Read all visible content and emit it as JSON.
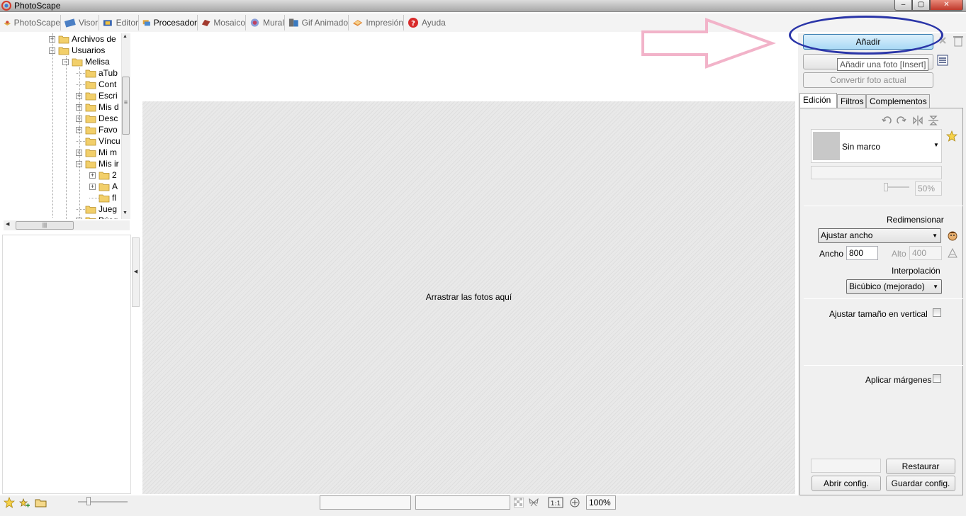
{
  "window": {
    "title": "PhotoScape",
    "controls": {
      "minimize": "–",
      "maximize": "▢",
      "close": "✕"
    }
  },
  "menu": {
    "tabs": [
      {
        "label": "PhotoScape",
        "icon": "photoscape-icon"
      },
      {
        "label": "Visor",
        "icon": "viewer-icon"
      },
      {
        "label": "Editor",
        "icon": "editor-icon"
      },
      {
        "label": "Procesador",
        "icon": "batch-icon",
        "active": true
      },
      {
        "label": "Mosaico",
        "icon": "page-icon"
      },
      {
        "label": "Mural",
        "icon": "combine-icon"
      },
      {
        "label": "Gif Animado",
        "icon": "gif-icon"
      },
      {
        "label": "Impresión",
        "icon": "print-icon"
      },
      {
        "label": "Ayuda",
        "icon": "help-icon"
      }
    ]
  },
  "tree": {
    "items": [
      {
        "label": "Archivos de",
        "expander": "+",
        "icon": "folder-icon"
      },
      {
        "label": "Usuarios",
        "expander": "−",
        "icon": "folder-icon"
      },
      {
        "label": "Melisa",
        "expander": "−",
        "icon": "folder-icon"
      },
      {
        "label": "aTub",
        "expander": "",
        "icon": "folder-icon"
      },
      {
        "label": "Cont",
        "expander": "",
        "icon": "contacts-icon"
      },
      {
        "label": "Escri",
        "expander": "+",
        "icon": "desktop-icon"
      },
      {
        "label": "Mis d",
        "expander": "+",
        "icon": "documents-icon"
      },
      {
        "label": "Desc",
        "expander": "+",
        "icon": "downloads-icon"
      },
      {
        "label": "Favo",
        "expander": "+",
        "icon": "favorites-star-icon"
      },
      {
        "label": "Víncu",
        "expander": "",
        "icon": "links-icon"
      },
      {
        "label": "Mi m",
        "expander": "+",
        "icon": "music-icon"
      },
      {
        "label": "Mis ir",
        "expander": "−",
        "icon": "pictures-icon"
      },
      {
        "label": "2",
        "expander": "+",
        "icon": "folder-icon"
      },
      {
        "label": "A",
        "expander": "+",
        "icon": "folder-icon"
      },
      {
        "label": "fl",
        "expander": "",
        "icon": "folder-icon"
      },
      {
        "label": "Jueg",
        "expander": "",
        "icon": "games-icon"
      },
      {
        "label": "Búsq",
        "expander": "+",
        "icon": "search-folder-icon"
      }
    ],
    "hscroll_grip": "|||",
    "vscroll_grip": "≡"
  },
  "collapse_arrow": "◀",
  "drop_area": {
    "text": "Arrastrar las fotos aquí"
  },
  "right_panel": {
    "add_button": "Añadir",
    "tooltip": "Añadir una foto [Insert]",
    "convert_button": "Convertir foto actual",
    "tabs": [
      {
        "label": "Edición",
        "active": true
      },
      {
        "label": "Filtros"
      },
      {
        "label": "Complementos"
      }
    ],
    "frame": {
      "selected": "Sin marco",
      "opacity": "50%"
    },
    "resize": {
      "heading": "Redimensionar",
      "mode": "Ajustar ancho",
      "width_label": "Ancho",
      "width_value": "800",
      "height_label": "Alto",
      "height_value": "400",
      "interp_heading": "Interpolación",
      "interp_value": "Bicúbico (mejorado)",
      "vertical_label": "Ajustar tamaño en vertical"
    },
    "margins_label": "Aplicar márgenes",
    "restore_button": "Restaurar",
    "open_config_button": "Abrir config.",
    "save_config_button": "Guardar config."
  },
  "status": {
    "zoom": "100%"
  },
  "colors": {
    "annotation_ellipse": "#2a35a8",
    "annotation_arrow": "#f2b3c9",
    "add_button_fill": "#a9d9f5"
  }
}
